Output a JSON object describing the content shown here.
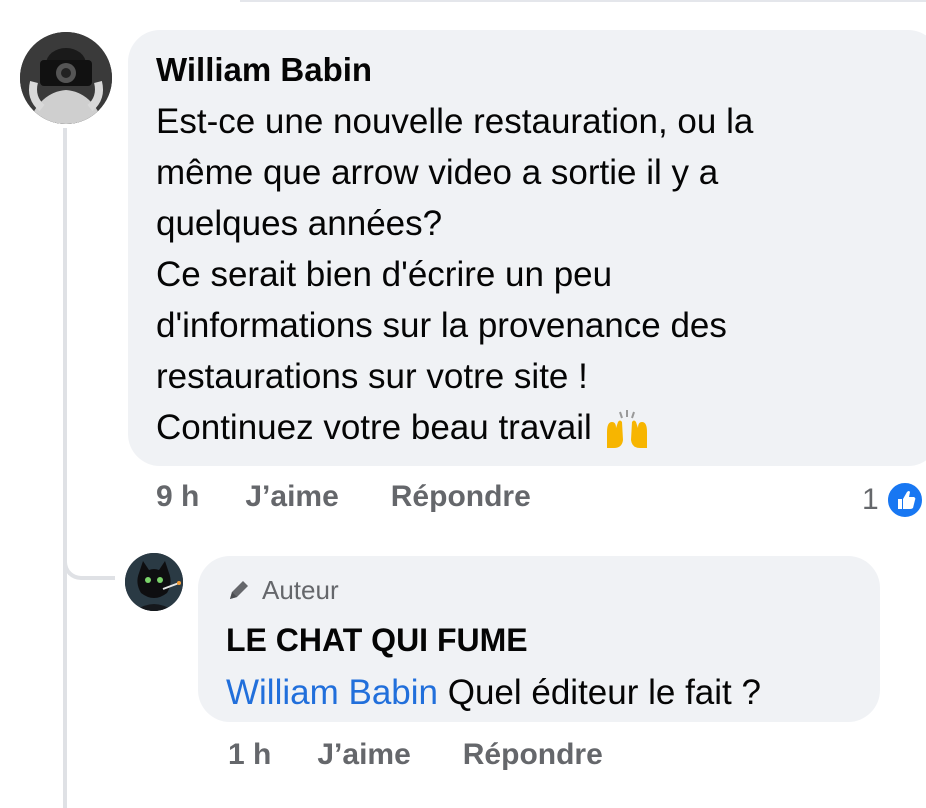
{
  "comment": {
    "author": "William Babin",
    "lines": [
      "Est-ce une nouvelle restauration, ou la",
      "même que arrow video a sortie il y a",
      "quelques années?",
      "Ce serait bien d'écrire un peu",
      "d'informations sur la provenance des",
      "restaurations sur votre site !",
      "Continuez votre beau travail"
    ],
    "emoji": "raising-hands-emoji",
    "time": "9 h",
    "like_label": "J’aime",
    "reply_label": "Répondre",
    "reaction_count": "1",
    "reaction_icon": "like-thumb-icon"
  },
  "reply": {
    "badge": "Auteur",
    "badge_icon": "pencil-icon",
    "author": "LE CHAT QUI FUME",
    "mention": "William Babin",
    "text": " Quel éditeur le fait ?",
    "time": "1 h",
    "like_label": "J’aime",
    "reply_label": "Répondre"
  },
  "colors": {
    "bubble": "#f0f2f5",
    "mention": "#216fdb",
    "meta": "#65676b",
    "like_blue": "#1877f2"
  }
}
